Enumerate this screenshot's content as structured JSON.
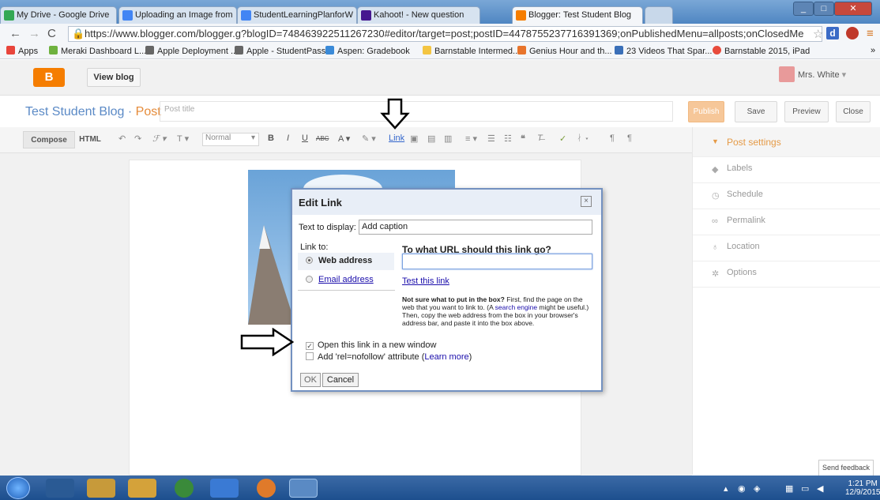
{
  "browser": {
    "tabs": [
      {
        "title": "My Drive - Google Drive",
        "color": "#34a853"
      },
      {
        "title": "Uploading an Image from",
        "color": "#4285f4"
      },
      {
        "title": "StudentLearningPlanforW",
        "color": "#4285f4"
      },
      {
        "title": "Kahoot! - New question",
        "color": "#46178f"
      },
      {
        "title": "Blogger: Test Student Blog",
        "color": "#f57d00"
      }
    ],
    "url": "https://www.blogger.com/blogger.g?blogID=748463922511267230#editor/target=post;postID=4478755237716391369;onPublishedMenu=allposts;onClosedMe",
    "bookmarks": [
      {
        "label": "Apps",
        "color": "#e8453c"
      },
      {
        "label": "Meraki Dashboard L...",
        "color": "#6fb23f"
      },
      {
        "label": "Apple Deployment ...",
        "color": "#666666"
      },
      {
        "label": "Apple - StudentPass...",
        "color": "#666666"
      },
      {
        "label": "Aspen: Gradebook",
        "color": "#3a8ad8"
      },
      {
        "label": "Barnstable Intermed...",
        "color": "#f4c542"
      },
      {
        "label": "Genius Hour and th...",
        "color": "#e8742c"
      },
      {
        "label": "23 Videos That Spar...",
        "color": "#3a6fb8"
      },
      {
        "label": "Barnstable 2015, iPad",
        "color": "#e84b3c"
      }
    ]
  },
  "header": {
    "logo": "B",
    "view_blog": "View blog",
    "user": "Mrs. White",
    "user_arrow": "▾"
  },
  "post": {
    "blog_name": "Test Student Blog",
    "separator": "·",
    "post_label": "Post",
    "title_placeholder": "Post title",
    "buttons": {
      "publish": "Publish",
      "save": "Save",
      "preview": "Preview",
      "close": "Close"
    }
  },
  "toolbar": {
    "compose": "Compose",
    "html": "HTML",
    "font_size": "Normal",
    "link": "Link"
  },
  "sidebar": {
    "post_settings": "Post settings",
    "items": [
      {
        "label": "Labels",
        "icon": "tag-icon"
      },
      {
        "label": "Schedule",
        "icon": "clock-icon"
      },
      {
        "label": "Permalink",
        "icon": "link-icon"
      },
      {
        "label": "Location",
        "icon": "pin-icon"
      },
      {
        "label": "Options",
        "icon": "gear-icon"
      }
    ]
  },
  "dialog": {
    "title": "Edit Link",
    "close": "×",
    "text_to_display_label": "Text to display:",
    "text_to_display_value": "Add caption",
    "link_to_label": "Link to:",
    "option_web": "Web address",
    "option_email": "Email address",
    "url_question": "To what URL should this link go?",
    "url_value": "",
    "test_link": "Test this link",
    "help_bold": "Not sure what to put in the box?",
    "help_part1": " First, find the page on the web that you want to link to. (A ",
    "help_link": "search engine",
    "help_part2": " might be useful.) Then, copy the web address from the box in your browser's address bar, and paste it into the box above.",
    "open_new_window": "Open this link in a new window",
    "open_new_window_checked": true,
    "nofollow_prefix": "Add 'rel=nofollow' attribute (",
    "nofollow_link": "Learn more",
    "nofollow_suffix": ")",
    "ok": "OK",
    "cancel": "Cancel"
  },
  "feedback": "Send feedback",
  "taskbar": {
    "time": "1:21 PM",
    "date": "12/9/2015"
  }
}
